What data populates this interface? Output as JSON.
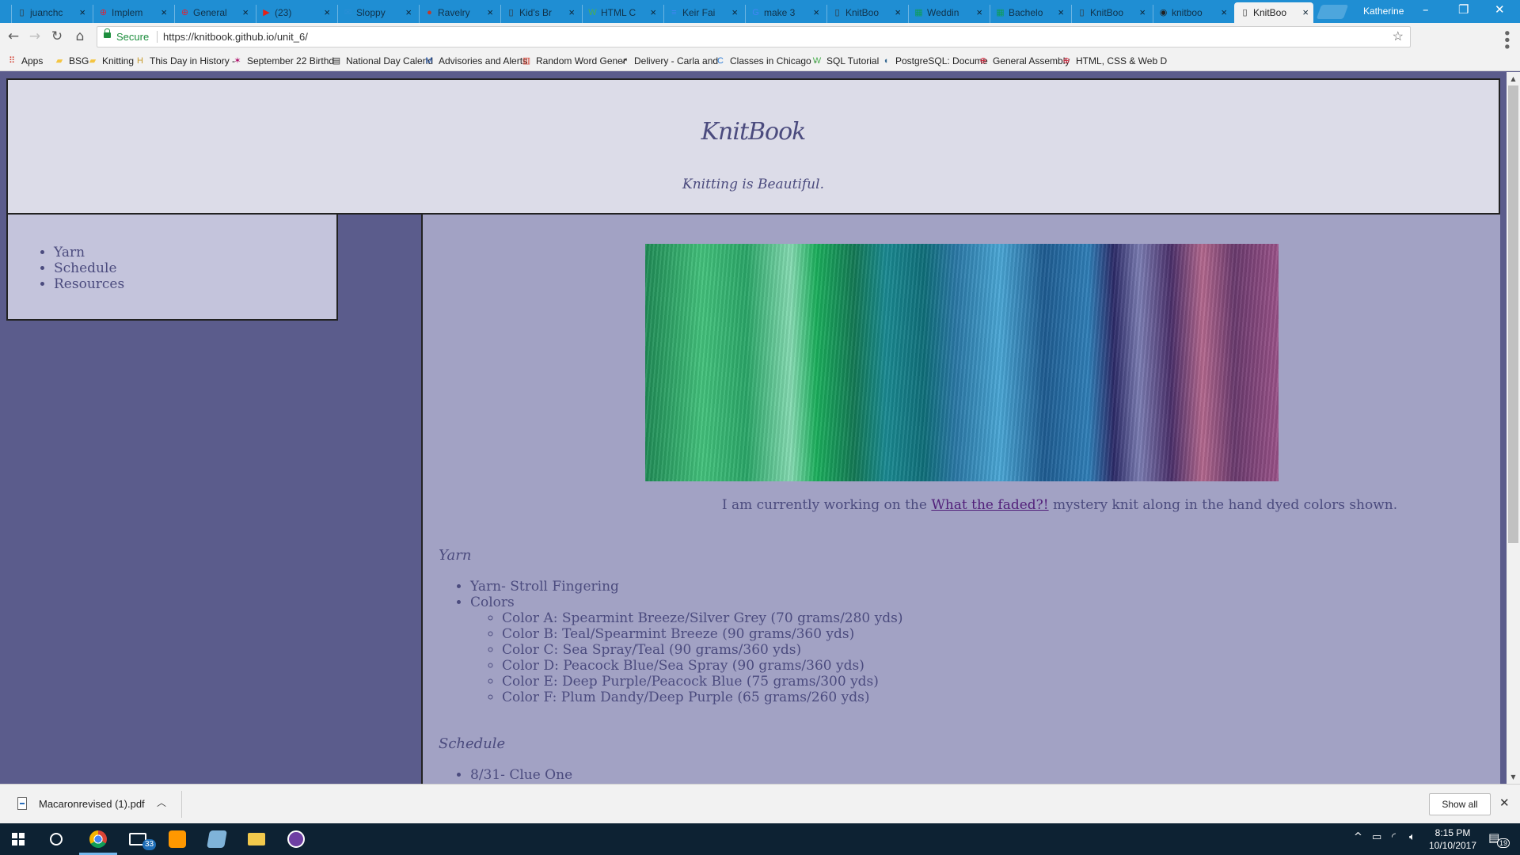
{
  "browser": {
    "tabs": [
      {
        "label": "juanchc",
        "icon": "page-icon"
      },
      {
        "label": "Implem",
        "icon": "ga-icon"
      },
      {
        "label": "General",
        "icon": "ga-icon"
      },
      {
        "label": "(23)",
        "icon": "youtube-icon"
      },
      {
        "label": "Sloppy",
        "icon": "bird-icon"
      },
      {
        "label": "Ravelry",
        "icon": "ravelry-icon"
      },
      {
        "label": "Kid's Br",
        "icon": "page-icon"
      },
      {
        "label": "HTML C",
        "icon": "w3-icon"
      },
      {
        "label": "Keir Fai",
        "icon": "docs-icon"
      },
      {
        "label": "make 3",
        "icon": "google-icon"
      },
      {
        "label": "KnitBoo",
        "icon": "page-icon"
      },
      {
        "label": "Weddin",
        "icon": "sheets-icon"
      },
      {
        "label": "Bachelo",
        "icon": "sheets-icon"
      },
      {
        "label": "KnitBoo",
        "icon": "page-icon"
      },
      {
        "label": "knitboo",
        "icon": "github-icon"
      },
      {
        "label": "KnitBoo",
        "icon": "page-icon"
      }
    ],
    "profile_name": "Katherine",
    "secure_label": "Secure",
    "url": "https://knitbook.github.io/unit_6/",
    "bookmarks": [
      {
        "label": "Apps",
        "icon": "apps-grid-icon"
      },
      {
        "label": "BSG",
        "icon": "folder-icon"
      },
      {
        "label": "Knitting",
        "icon": "folder-icon"
      },
      {
        "label": "This Day in History -",
        "icon": "history-icon"
      },
      {
        "label": "September 22 Birthd",
        "icon": "star-burst-icon"
      },
      {
        "label": "National Day Calend",
        "icon": "calendar-icon"
      },
      {
        "label": "Advisories and Alerts",
        "icon": "m-logo-icon"
      },
      {
        "label": "Random Word Gener",
        "icon": "word-icon"
      },
      {
        "label": "Delivery - Carla and",
        "icon": "delivery-icon"
      },
      {
        "label": "Classes in Chicago -",
        "icon": "classes-icon"
      },
      {
        "label": "SQL Tutorial",
        "icon": "w3-icon"
      },
      {
        "label": "PostgreSQL: Docume",
        "icon": "elephant-icon"
      },
      {
        "label": "General Assembly",
        "icon": "ga-icon"
      },
      {
        "label": "HTML, CSS & Web D",
        "icon": "ga-icon"
      }
    ]
  },
  "page": {
    "logo_text": "KnitBook",
    "tagline": "Knitting is Beautiful.",
    "nav": [
      "Yarn",
      "Schedule",
      "Resources"
    ],
    "hero_image_alt": "hand dyed yarn skeins",
    "caption_before": "I am currently working on the ",
    "caption_link": "What the faded?!",
    "caption_after": " mystery knit along in the hand dyed colors shown.",
    "yarn_title": "Yarn",
    "yarn_items": [
      "Yarn- Stroll Fingering",
      "Colors"
    ],
    "colors": [
      "Color A: Spearmint Breeze/Silver Grey (70 grams/280 yds)",
      "Color B: Teal/Spearmint Breeze (90 grams/360 yds)",
      "Color C: Sea Spray/Teal (90 grams/360 yds)",
      "Color D: Peacock Blue/Sea Spray (90 grams/360 yds)",
      "Color E: Deep Purple/Peacock Blue (75 grams/300 yds)",
      "Color F: Plum Dandy/Deep Purple (65 grams/260 yds)"
    ],
    "schedule_title": "Schedule",
    "schedule_items": [
      "8/31- Clue One"
    ]
  },
  "downloads": {
    "file_name": "Macaronrevised (1).pdf",
    "show_all": "Show all"
  },
  "taskbar": {
    "mail_badge": "33",
    "time": "8:15 PM",
    "date": "10/10/2017",
    "notification_count": "19"
  },
  "colors": {
    "page_bg": "#5b5c8c",
    "header_bg": "#dcdce8",
    "nav_bg": "#c4c4dc",
    "main_bg": "#a2a2c4",
    "text": "#4b4b7e",
    "link": "#52207a"
  }
}
